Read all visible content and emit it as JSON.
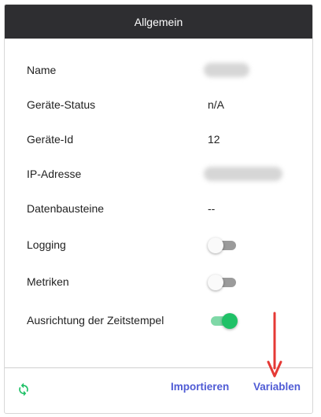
{
  "header": {
    "title": "Allgemein"
  },
  "rows": [
    {
      "label": "Name",
      "value": ""
    },
    {
      "label": "Geräte-Status",
      "value": "n/A"
    },
    {
      "label": "Geräte-Id",
      "value": "12"
    },
    {
      "label": "IP-Adresse",
      "value": ""
    },
    {
      "label": "Datenbausteine",
      "value": "--"
    },
    {
      "label": "Logging"
    },
    {
      "label": "Metriken"
    },
    {
      "label": "Ausrichtung der Zeitstempel"
    }
  ],
  "toggles": {
    "logging": false,
    "metriken": false,
    "zeitstempel": true
  },
  "footer": {
    "import_label": "Importieren",
    "variables_label": "Variablen"
  },
  "colors": {
    "accent": "#4f5bd5",
    "toggle_on": "#20c167",
    "header_bg": "#2e2e31",
    "arrow": "#e53935"
  },
  "icons": {
    "refresh": "refresh-icon"
  }
}
